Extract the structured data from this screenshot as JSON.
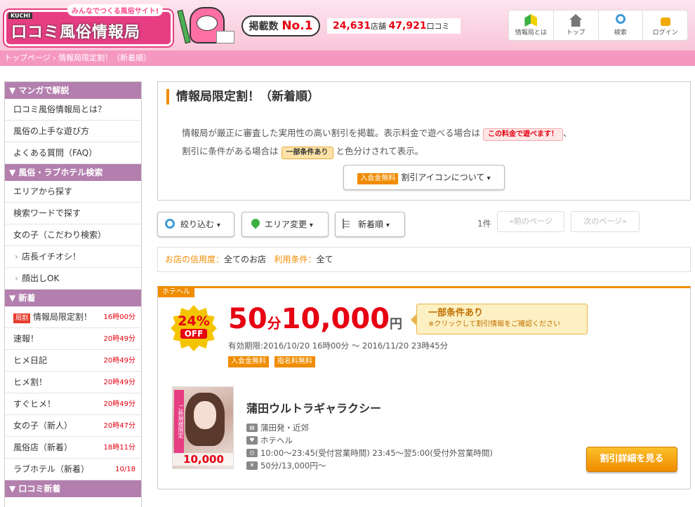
{
  "header": {
    "tagline": "みんなでつくる風俗サイト!",
    "logo_kuchi": "KUCHI",
    "logo_text": "口コミ風俗情報局",
    "listing_label": "掲載数",
    "listing_value": "No.1",
    "shop_count": "24,631",
    "shop_unit": "店舗",
    "review_count": "47,921",
    "review_unit": "口コミ",
    "nav": [
      {
        "label": "情報局とは",
        "icon": "beginner-leaf-icon"
      },
      {
        "label": "トップ",
        "icon": "home-icon"
      },
      {
        "label": "検索",
        "icon": "search-icon"
      },
      {
        "label": "ログイン",
        "icon": "lock-icon"
      }
    ]
  },
  "breadcrumb": "トップページ › 情報局限定割！（新着順）",
  "sidebar": {
    "sections": [
      {
        "title": "▼ マンガで解説",
        "items": [
          "口コミ風俗情報局とは？",
          "風俗の上手な遊び方",
          "よくある質問（FAQ）"
        ]
      },
      {
        "title": "▼ 風俗・ラブホテル検索",
        "items": [
          "エリアから探す",
          "検索ワードで探す",
          "女の子（こだわり検索）"
        ],
        "sub_items": [
          "店長イチオシ！",
          "顔出しOK"
        ]
      },
      {
        "title": "▼ 新着",
        "items": [
          {
            "label": "情報局限定割！",
            "time": "16時00分",
            "tag": "局割"
          },
          {
            "label": "速報！",
            "time": "20時49分"
          },
          {
            "label": "ヒメ日記",
            "time": "20時49分"
          },
          {
            "label": "ヒメ割！",
            "time": "20時49分"
          },
          {
            "label": "すぐヒメ！",
            "time": "20時49分"
          },
          {
            "label": "女の子（新人）",
            "time": "20時47分"
          },
          {
            "label": "風俗店（新着）",
            "time": "18時11分"
          },
          {
            "label": "ラブホテル（新着）",
            "time": "10/18"
          }
        ]
      },
      {
        "title": "▼ 口コミ新着"
      }
    ]
  },
  "main": {
    "title": "情報局限定割！（新着順）",
    "intro_line1": "情報局が厳正に審査した実用性の高い割引を掲載。表示料金で遊べる場合は",
    "pill_red": "この料金で遊べます！",
    "intro_line1_end": "、",
    "intro_line2_a": "割引に条件がある場合は",
    "pill_orange": "一部条件あり",
    "intro_line2_b": "と色分けされて表示。",
    "icon_button_tag": "入会金無料",
    "icon_button_label": "割引アイコンについて",
    "filters": {
      "narrow": "絞り込む",
      "area": "エリア変更",
      "sort": "新着順"
    },
    "count": "1件",
    "prev": "«前のページ",
    "next": "次のページ»",
    "condition": {
      "credit_label": "お店の信用度：",
      "credit_value": "全てのお店",
      "usage_label": "利用条件：",
      "usage_value": "全て"
    }
  },
  "card": {
    "category": "ホテヘル",
    "discount_pct": "24%",
    "discount_off": "OFF",
    "minutes": "50",
    "minutes_unit": "分",
    "price": "10,000",
    "price_unit": "円",
    "cond_main": "一部条件あり",
    "cond_sub": "※クリックして割引情報をご確認ください",
    "validity": "有効期限:2016/10/20 16時00分 ～ 2016/11/20 23時45分",
    "tags": [
      "入会金無料",
      "指名料無料"
    ],
    "photo_band": "ご新規様限定",
    "photo_price": "10,000",
    "shop_name": "蒲田ウルトラギャラクシー",
    "area": "蒲田発・近郊",
    "genre": "ホテヘル",
    "hours": "10:00～23:45(受付営業時間) 23:45～翌5:00(受付外営業時間)",
    "fee": "50分/13,000円～",
    "detail_button": "割引詳細を見る"
  }
}
